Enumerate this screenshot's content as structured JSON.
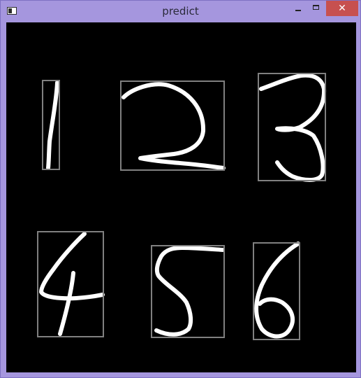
{
  "window": {
    "title": "predict",
    "close_glyph": "✕"
  },
  "colors": {
    "titlebar": "#a596de",
    "close_button": "#c7504f",
    "canvas": "#000000",
    "stroke": "#ffffff",
    "bounding_box": "#808080"
  },
  "icons": [
    "app-icon",
    "minimize-icon",
    "maximize-icon",
    "close-icon"
  ],
  "digits": [
    {
      "label": "1"
    },
    {
      "label": "2"
    },
    {
      "label": "3"
    },
    {
      "label": "4"
    },
    {
      "label": "5"
    },
    {
      "label": "6"
    }
  ]
}
